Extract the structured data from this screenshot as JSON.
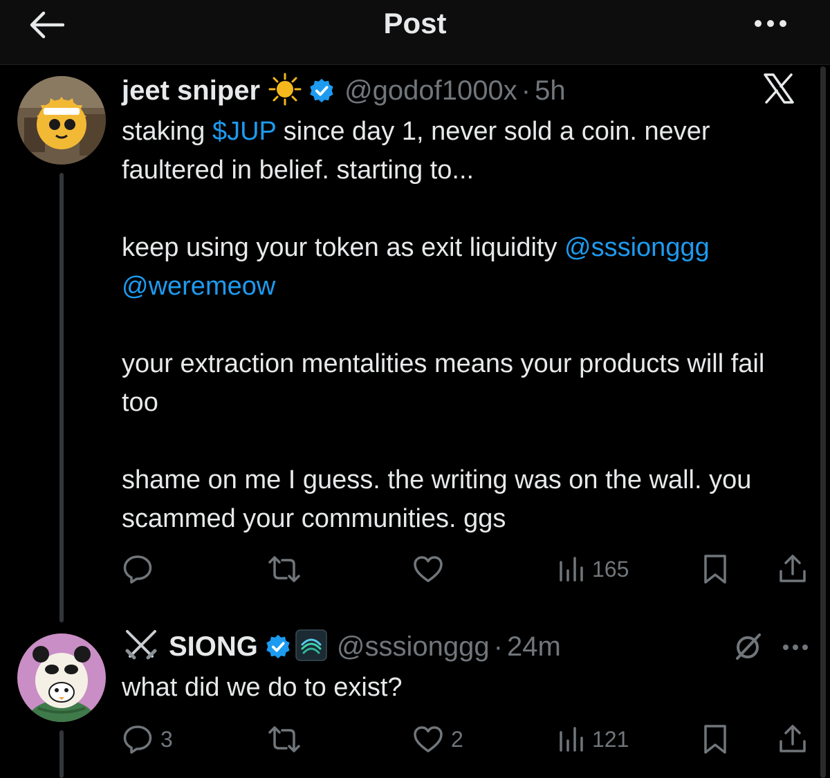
{
  "header": {
    "title": "Post"
  },
  "colors": {
    "accent": "#1d9bf0",
    "muted": "#71767b",
    "text": "#e7e9ea",
    "background": "#000000"
  },
  "posts": [
    {
      "name": "jeet sniper",
      "handle": "@godof1000x",
      "separator": "·",
      "time": "5h",
      "text": {
        "p1_pre": "staking ",
        "p1_link": "$JUP",
        "p1_post": " since day 1, never sold a coin. never faultered in belief. starting to...",
        "p2_pre": "keep using your token as exit liquidity ",
        "p2_link1": "@sssionggg",
        "p2_link2": "@weremeow",
        "p3": "your extraction mentalities means your products will fail too",
        "p4": "shame on me I guess. the writing was on the wall. you scammed your communities. ggs"
      },
      "stats": {
        "replies": "",
        "reposts": "",
        "likes": "",
        "views": "165"
      },
      "icons": [
        "sun-emoji-icon",
        "verified-badge-icon",
        "x-logo-icon"
      ]
    },
    {
      "name": "SIONG",
      "handle": "@sssionggg",
      "separator": "·",
      "time": "24m",
      "text": "what did we do to exist?",
      "stats": {
        "replies": "3",
        "reposts": "",
        "likes": "2",
        "views": "121"
      },
      "icons": [
        "crossed-swords-emoji-icon",
        "verified-badge-icon",
        "affiliate-badge-icon",
        "grok-icon"
      ]
    }
  ]
}
